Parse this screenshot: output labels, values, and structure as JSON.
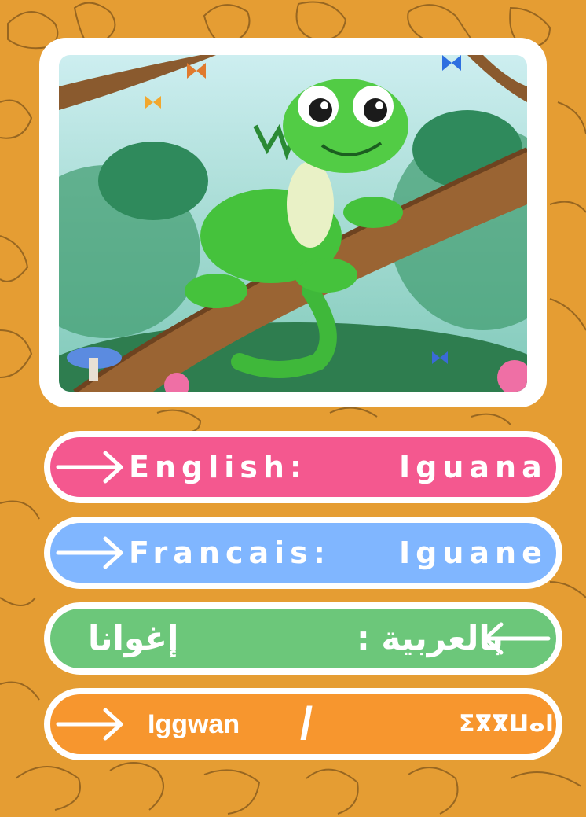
{
  "illustration": {
    "subject": "green cartoon iguana on jungle branch"
  },
  "rows": [
    {
      "label": "English:",
      "value": "Iguana",
      "color": "#f4588f"
    },
    {
      "label": "Francais:",
      "value": "Iguane",
      "color": "#80b6ff"
    },
    {
      "label": "بالعربية :",
      "value": "إغوانا",
      "color": "#6cc77a"
    },
    {
      "latin": "Iggwan",
      "separator": "/",
      "tifinagh": "ⵉⴳⴳⵡⴰⵏ",
      "color": "#f7962e"
    }
  ],
  "colors": {
    "background": "#e59d33",
    "frame": "#ffffff",
    "doodle": "#5a3a12"
  },
  "icons": [
    "right-arrow-icon",
    "left-arrow-icon"
  ]
}
